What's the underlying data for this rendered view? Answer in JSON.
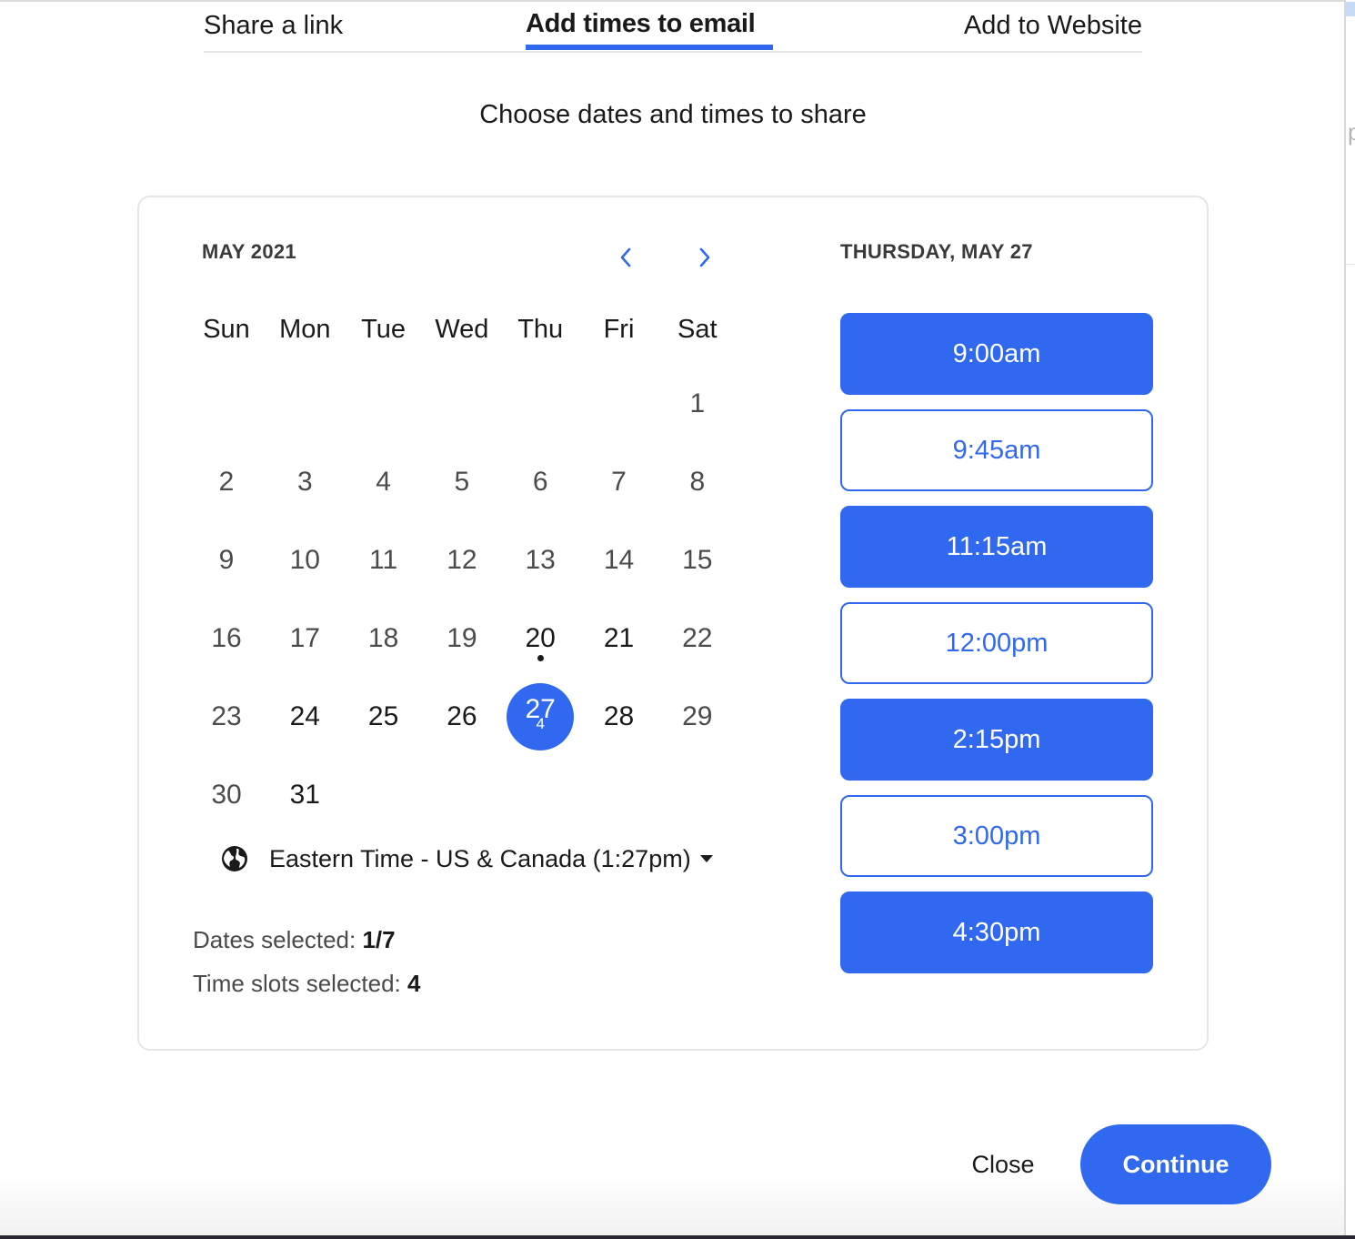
{
  "tabs": [
    {
      "label": "Share a link",
      "active": false
    },
    {
      "label": "Add times to email",
      "active": true
    },
    {
      "label": "Add to Website",
      "active": false
    }
  ],
  "subtitle": "Choose dates and times to share",
  "calendar": {
    "month_label": "MAY 2021",
    "prev_icon": "chevron-left-icon",
    "next_icon": "chevron-right-icon",
    "weekdays": [
      "Sun",
      "Mon",
      "Tue",
      "Wed",
      "Thu",
      "Fri",
      "Sat"
    ],
    "first_weekday_index": 6,
    "days_in_month": 31,
    "available_days": [
      20,
      21,
      24,
      25,
      26,
      27,
      28,
      31
    ],
    "today": 20,
    "selected_day": 27,
    "selected_day_slot_count": "4"
  },
  "timezone": {
    "icon": "globe-icon",
    "label": "Eastern Time - US & Canada (1:27pm)"
  },
  "stats": {
    "dates_label": "Dates selected:",
    "dates_value": "1/7",
    "slots_label": "Time slots selected:",
    "slots_value": "4"
  },
  "times": {
    "heading": "THURSDAY, MAY 27",
    "slots": [
      {
        "label": "9:00am",
        "selected": true
      },
      {
        "label": "9:45am",
        "selected": false
      },
      {
        "label": "11:15am",
        "selected": true
      },
      {
        "label": "12:00pm",
        "selected": false
      },
      {
        "label": "2:15pm",
        "selected": true
      },
      {
        "label": "3:00pm",
        "selected": false
      },
      {
        "label": "4:30pm",
        "selected": true
      }
    ]
  },
  "footer": {
    "close_label": "Close",
    "continue_label": "Continue"
  },
  "colors": {
    "accent": "#3069f0",
    "text": "#1a1a1a",
    "muted_text": "#4b4b4b",
    "border": "#e6e6e6"
  }
}
